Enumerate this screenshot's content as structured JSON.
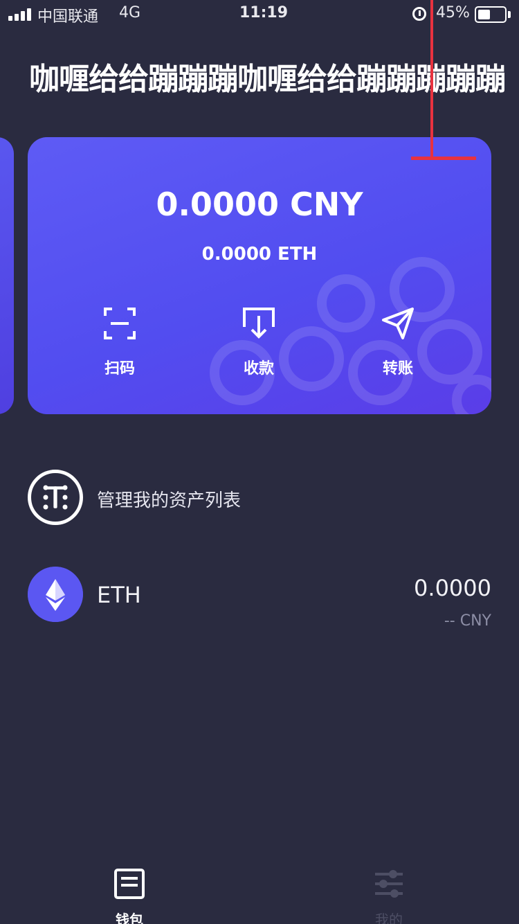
{
  "status_bar": {
    "carrier": "中国联通",
    "network": "4G",
    "time": "11:19",
    "battery_percent": "45%"
  },
  "wallet": {
    "name": "咖喱给给蹦蹦蹦咖喱给给蹦蹦蹦蹦蹦"
  },
  "card": {
    "balance_fiat": "0.0000 CNY",
    "balance_crypto": "0.0000 ETH",
    "actions": {
      "scan_label": "扫码",
      "receive_label": "收款",
      "transfer_label": "转账"
    }
  },
  "manage": {
    "label": "管理我的资产列表"
  },
  "assets": [
    {
      "symbol": "ETH",
      "amount": "0.0000",
      "fiat": "-- CNY"
    }
  ],
  "tabs": {
    "wallet_label": "钱包",
    "mine_label": "我的"
  },
  "colors": {
    "background": "#2a2b40",
    "card_accent": "#5652f2",
    "annotation_red": "#e8323f"
  }
}
